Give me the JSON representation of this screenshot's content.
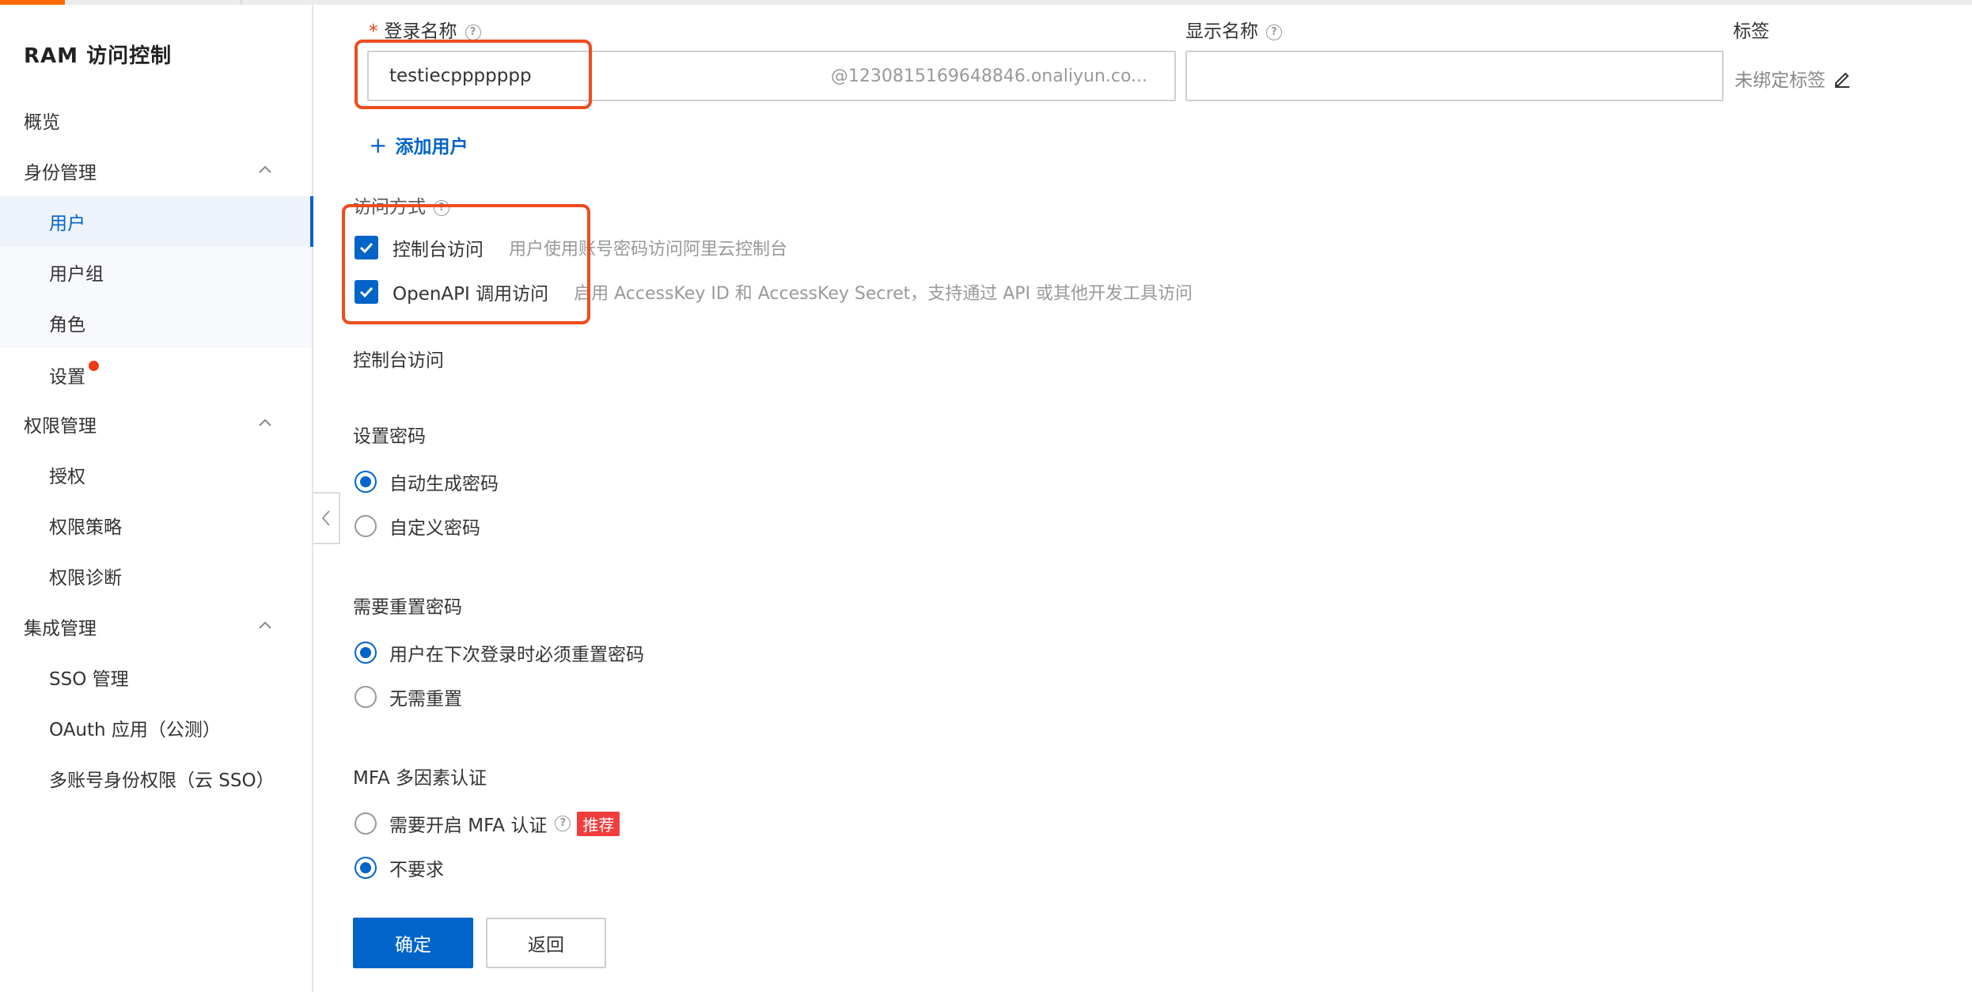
{
  "sidebar": {
    "title": "RAM 访问控制",
    "items": [
      {
        "label": "概览"
      },
      {
        "label": "身份管理"
      },
      {
        "label": "用户"
      },
      {
        "label": "用户组"
      },
      {
        "label": "角色"
      },
      {
        "label": "设置"
      },
      {
        "label": "权限管理"
      },
      {
        "label": "授权"
      },
      {
        "label": "权限策略"
      },
      {
        "label": "权限诊断"
      },
      {
        "label": "集成管理"
      },
      {
        "label": "SSO 管理"
      },
      {
        "label": "OAuth 应用（公测）"
      },
      {
        "label": "多账号身份权限（云 SSO）"
      }
    ]
  },
  "form": {
    "login_name_label": "登录名称",
    "login_name_required": "*",
    "login_name_value": "testiecppppppp",
    "login_name_suffix": "@1230815169648846.onaliyun.co...",
    "display_name_label": "显示名称",
    "display_name_value": "",
    "tag_label": "标签",
    "tag_value": "未绑定标签",
    "add_user_label": "添加用户",
    "access_mode_label": "访问方式",
    "console_access_label": "控制台访问",
    "console_access_desc": "用户使用账号密码访问阿里云控制台",
    "openapi_access_label": "OpenAPI 调用访问",
    "openapi_access_desc": "启用 AccessKey ID 和 AccessKey Secret，支持通过 API 或其他开发工具访问",
    "console_section_title": "控制台访问",
    "set_password_label": "设置密码",
    "auto_password_label": "自动生成密码",
    "custom_password_label": "自定义密码",
    "reset_password_label": "需要重置密码",
    "reset_next_login_label": "用户在下次登录时必须重置密码",
    "no_reset_label": "无需重置",
    "mfa_label": "MFA 多因素认证",
    "mfa_required_label": "需要开启 MFA 认证",
    "mfa_recommend_badge": "推荐",
    "mfa_not_required_label": "不要求"
  },
  "actions": {
    "confirm_label": "确定",
    "back_label": "返回"
  },
  "colors": {
    "primary": "#0064c8",
    "highlight": "#f04b1e",
    "badge": "#f23d3d",
    "brand_accent": "#ff6a00"
  }
}
